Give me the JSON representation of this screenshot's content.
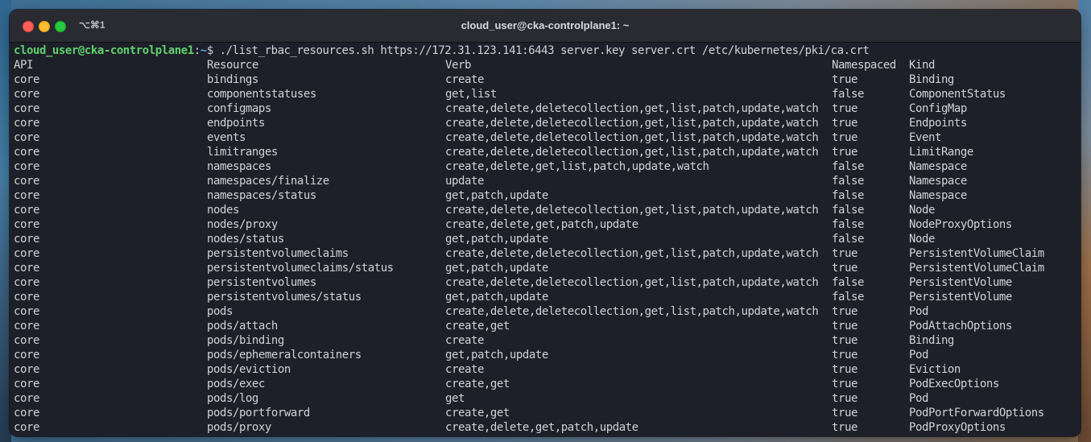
{
  "window": {
    "title": "cloud_user@cka-controlplane1: ~",
    "shortcut": "⌥⌘1"
  },
  "prompt": {
    "user_host": "cloud_user@cka-controlplane1",
    "separator": ":",
    "path": "~",
    "symbol": "$ ",
    "command": "./list_rbac_resources.sh https://172.31.123.141:6443 server.key server.crt /etc/kubernetes/pki/ca.crt"
  },
  "colors": {
    "prompt_user": "#5fd16d",
    "prompt_path": "#5b9cf0",
    "terminal_bg": "#1e2029",
    "terminal_text": "#d0d2d8"
  },
  "table": {
    "headers": [
      "API",
      "Resource",
      "Verb",
      "Namespaced",
      "Kind"
    ],
    "rows": [
      [
        "core",
        "bindings",
        "create",
        "true",
        "Binding"
      ],
      [
        "core",
        "componentstatuses",
        "get,list",
        "false",
        "ComponentStatus"
      ],
      [
        "core",
        "configmaps",
        "create,delete,deletecollection,get,list,patch,update,watch",
        "true",
        "ConfigMap"
      ],
      [
        "core",
        "endpoints",
        "create,delete,deletecollection,get,list,patch,update,watch",
        "true",
        "Endpoints"
      ],
      [
        "core",
        "events",
        "create,delete,deletecollection,get,list,patch,update,watch",
        "true",
        "Event"
      ],
      [
        "core",
        "limitranges",
        "create,delete,deletecollection,get,list,patch,update,watch",
        "true",
        "LimitRange"
      ],
      [
        "core",
        "namespaces",
        "create,delete,get,list,patch,update,watch",
        "false",
        "Namespace"
      ],
      [
        "core",
        "namespaces/finalize",
        "update",
        "false",
        "Namespace"
      ],
      [
        "core",
        "namespaces/status",
        "get,patch,update",
        "false",
        "Namespace"
      ],
      [
        "core",
        "nodes",
        "create,delete,deletecollection,get,list,patch,update,watch",
        "false",
        "Node"
      ],
      [
        "core",
        "nodes/proxy",
        "create,delete,get,patch,update",
        "false",
        "NodeProxyOptions"
      ],
      [
        "core",
        "nodes/status",
        "get,patch,update",
        "false",
        "Node"
      ],
      [
        "core",
        "persistentvolumeclaims",
        "create,delete,deletecollection,get,list,patch,update,watch",
        "true",
        "PersistentVolumeClaim"
      ],
      [
        "core",
        "persistentvolumeclaims/status",
        "get,patch,update",
        "true",
        "PersistentVolumeClaim"
      ],
      [
        "core",
        "persistentvolumes",
        "create,delete,deletecollection,get,list,patch,update,watch",
        "false",
        "PersistentVolume"
      ],
      [
        "core",
        "persistentvolumes/status",
        "get,patch,update",
        "false",
        "PersistentVolume"
      ],
      [
        "core",
        "pods",
        "create,delete,deletecollection,get,list,patch,update,watch",
        "true",
        "Pod"
      ],
      [
        "core",
        "pods/attach",
        "create,get",
        "true",
        "PodAttachOptions"
      ],
      [
        "core",
        "pods/binding",
        "create",
        "true",
        "Binding"
      ],
      [
        "core",
        "pods/ephemeralcontainers",
        "get,patch,update",
        "true",
        "Pod"
      ],
      [
        "core",
        "pods/eviction",
        "create",
        "true",
        "Eviction"
      ],
      [
        "core",
        "pods/exec",
        "create,get",
        "true",
        "PodExecOptions"
      ],
      [
        "core",
        "pods/log",
        "get",
        "true",
        "Pod"
      ],
      [
        "core",
        "pods/portforward",
        "create,get",
        "true",
        "PodPortForwardOptions"
      ],
      [
        "core",
        "pods/proxy",
        "create,delete,get,patch,update",
        "true",
        "PodProxyOptions"
      ]
    ]
  }
}
